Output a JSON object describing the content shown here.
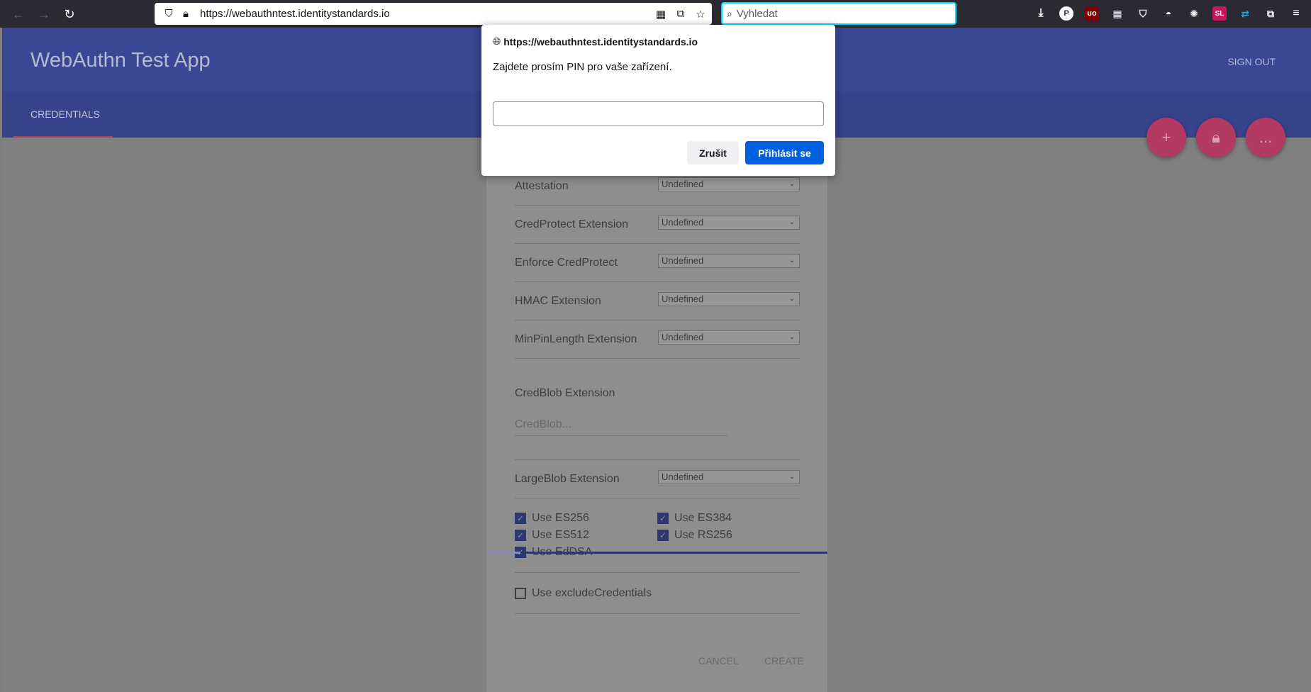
{
  "browser": {
    "url": "https://webauthntest.identitystandards.io",
    "search_placeholder": "Vyhledat"
  },
  "app": {
    "title": "WebAuthn Test App",
    "sign_out": "SIGN OUT",
    "tab": "CREDENTIALS",
    "fabs": [
      "+",
      "lock",
      "..."
    ]
  },
  "dialog": {
    "rows": [
      {
        "label": "Attestation",
        "value": "Undefined"
      },
      {
        "label": "CredProtect Extension",
        "value": "Undefined"
      },
      {
        "label": "Enforce CredProtect",
        "value": "Undefined"
      },
      {
        "label": "HMAC Extension",
        "value": "Undefined"
      },
      {
        "label": "MinPinLength Extension",
        "value": "Undefined"
      }
    ],
    "credblob_label": "CredBlob Extension",
    "credblob_placeholder": "CredBlob...",
    "largeblob_label": "LargeBlob Extension",
    "largeblob_value": "Undefined",
    "checkboxes": [
      {
        "label": "Use ES256",
        "checked": true
      },
      {
        "label": "Use ES384",
        "checked": true
      },
      {
        "label": "Use ES512",
        "checked": true
      },
      {
        "label": "Use RS256",
        "checked": true
      },
      {
        "label": "Use EdDSA",
        "checked": true
      }
    ],
    "exclude_label": "Use excludeCredentials",
    "cancel": "CANCEL",
    "create": "CREATE"
  },
  "prompt": {
    "origin": "https://webauthntest.identitystandards.io",
    "message": "Zajdete prosím PIN pro vaše zařízení.",
    "cancel": "Zrušit",
    "confirm": "Přihlásit se"
  }
}
